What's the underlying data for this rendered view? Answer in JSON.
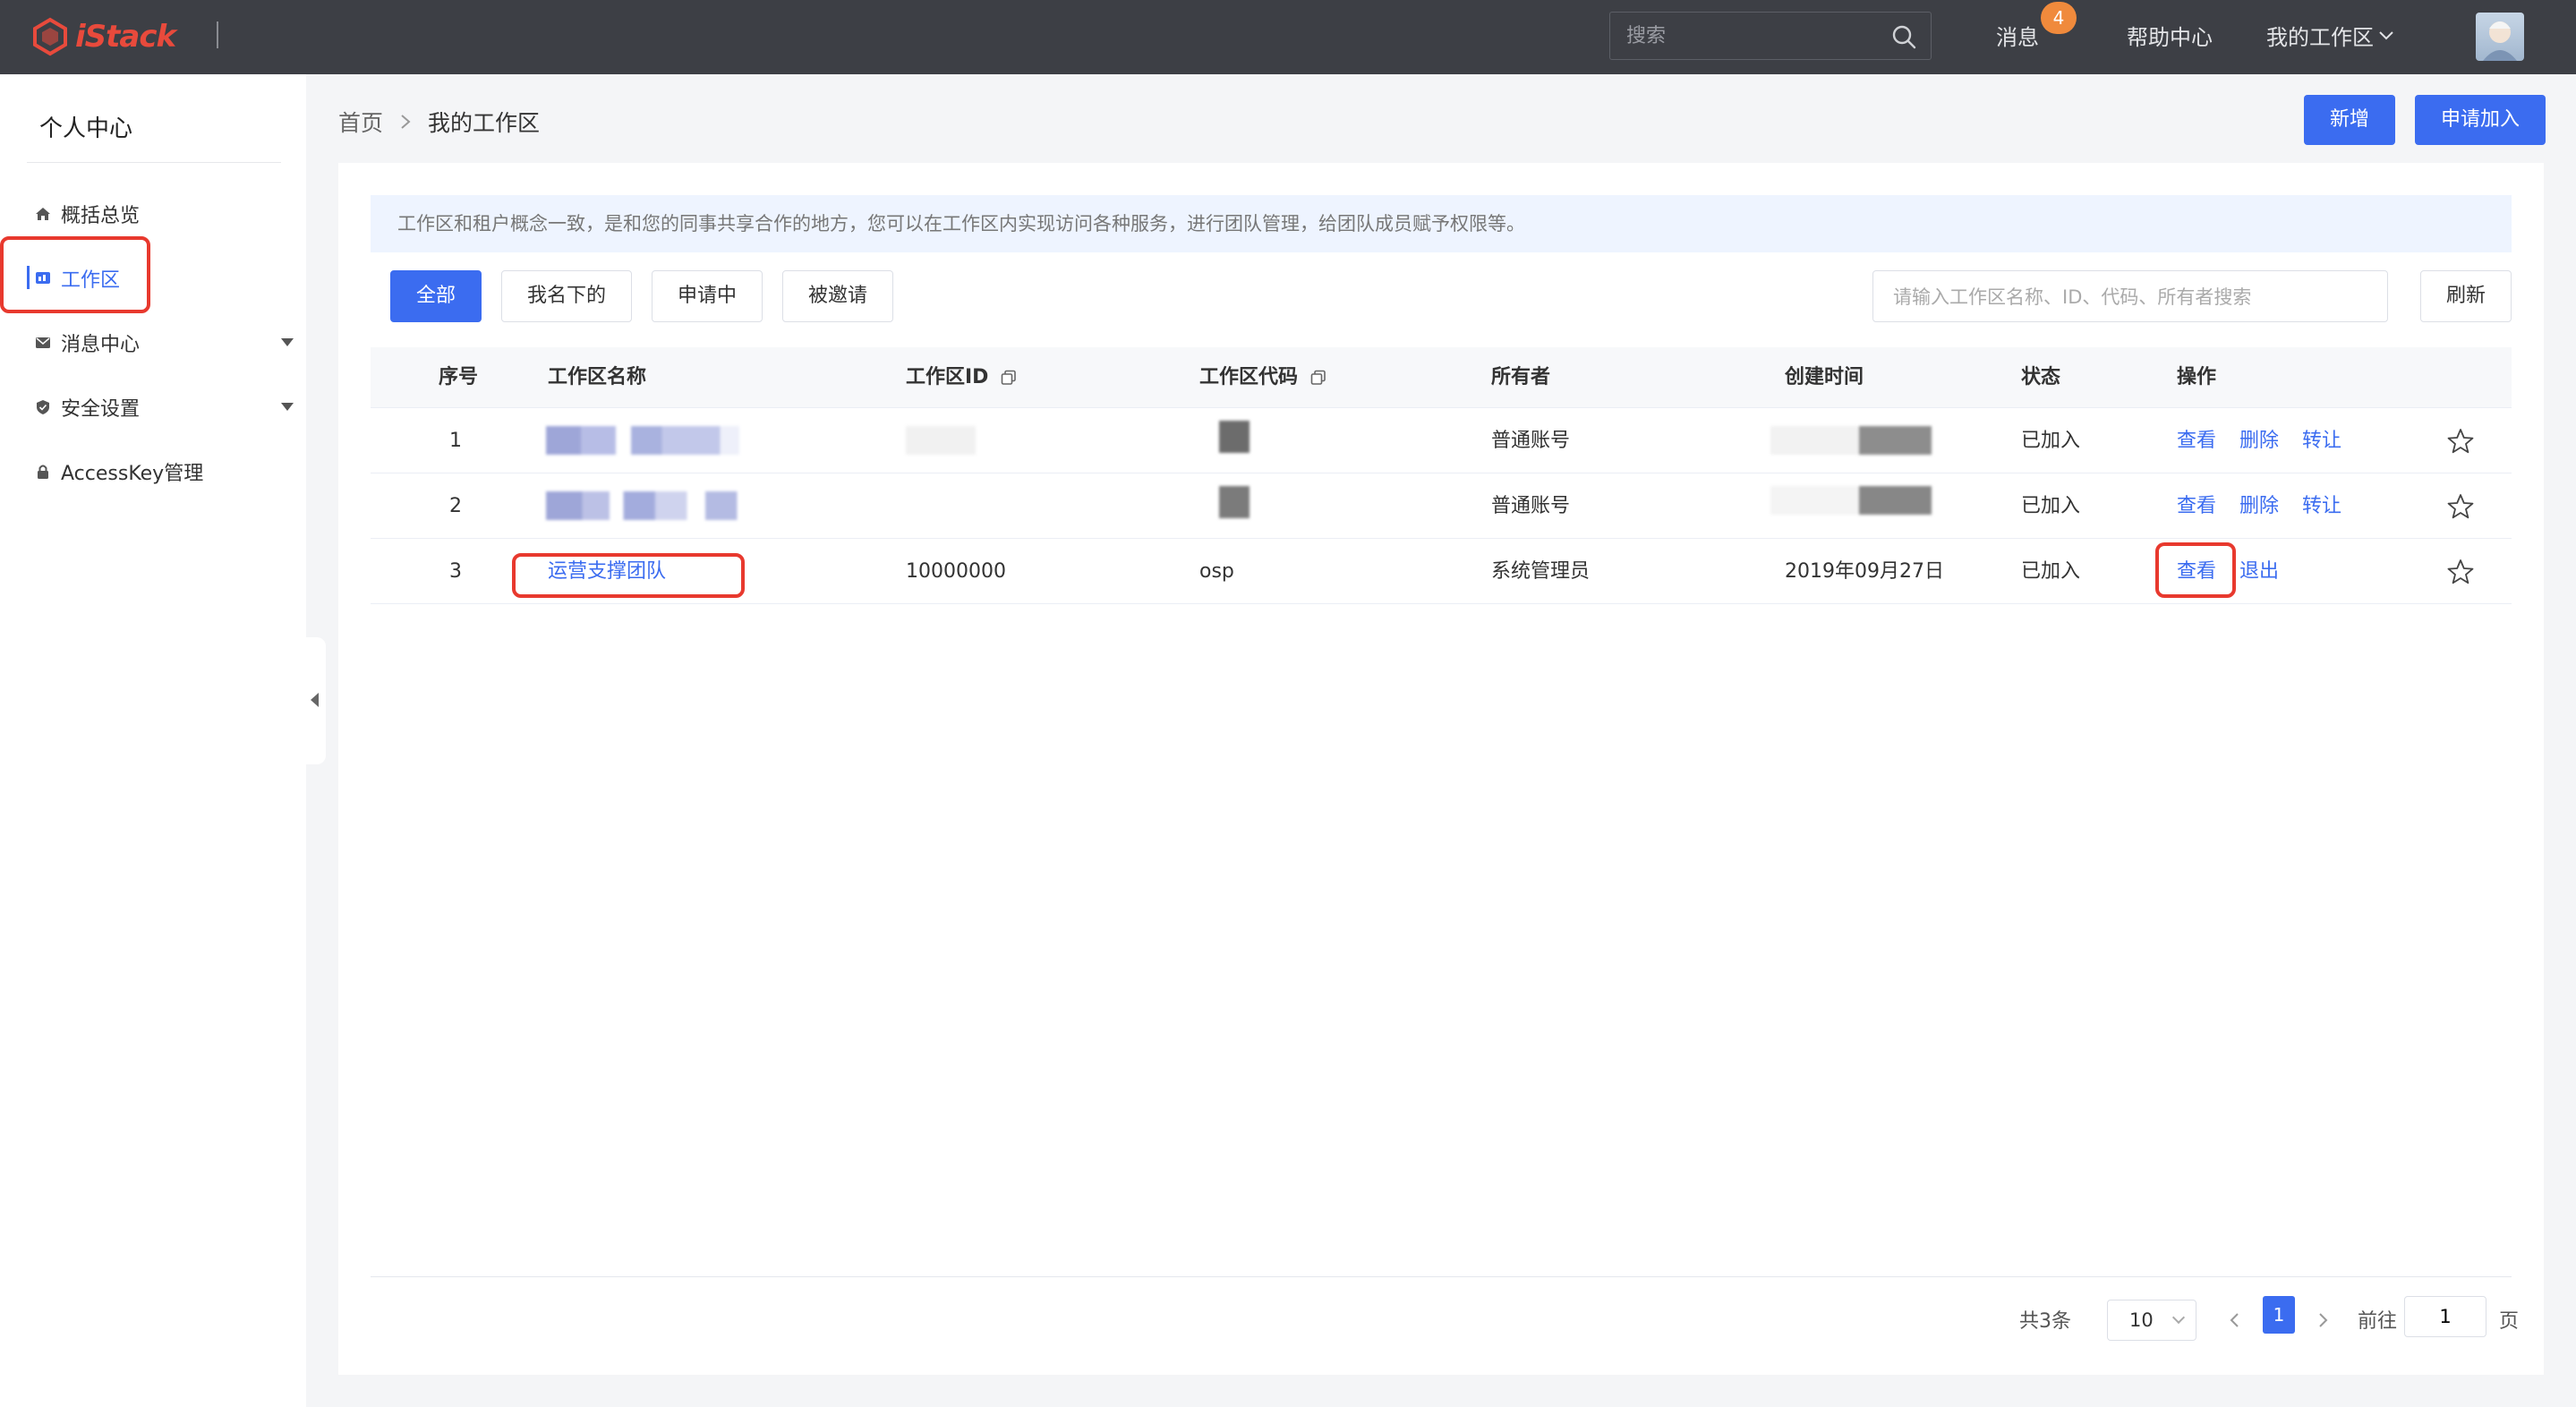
{
  "topbar": {
    "logo_text": "iStack",
    "search_placeholder": "搜索",
    "messages_label": "消息",
    "messages_badge": "4",
    "help_label": "帮助中心",
    "workspace_menu_label": "我的工作区"
  },
  "sidebar": {
    "title": "个人中心",
    "items": [
      {
        "label": "概括总览",
        "icon": "home-icon"
      },
      {
        "label": "工作区",
        "icon": "workspace-icon"
      },
      {
        "label": "消息中心",
        "icon": "mail-icon"
      },
      {
        "label": "安全设置",
        "icon": "shield-icon"
      },
      {
        "label": "AccessKey管理",
        "icon": "lock-icon"
      }
    ]
  },
  "breadcrumb": {
    "home": "首页",
    "current": "我的工作区"
  },
  "header_buttons": {
    "add": "新增",
    "apply_join": "申请加入"
  },
  "notice": "工作区和租户概念一致，是和您的同事共享合作的地方，您可以在工作区内实现访问各种服务，进行团队管理，给团队成员赋予权限等。",
  "filters": {
    "all": "全部",
    "mine": "我名下的",
    "applying": "申请中",
    "invited": "被邀请"
  },
  "search": {
    "placeholder": "请输入工作区名称、ID、代码、所有者搜索",
    "refresh": "刷新"
  },
  "table": {
    "headers": [
      "序号",
      "工作区名称",
      "工作区ID",
      "工作区代码",
      "所有者",
      "创建时间",
      "状态",
      "操作"
    ],
    "rows": [
      {
        "index": "1",
        "name": "",
        "id": "",
        "code": "",
        "owner": "普通账号",
        "created": "",
        "status": "已加入",
        "actions": [
          "查看",
          "删除",
          "转让"
        ]
      },
      {
        "index": "2",
        "name": "",
        "id": "",
        "code": "",
        "owner": "普通账号",
        "created": "",
        "status": "已加入",
        "actions": [
          "查看",
          "删除",
          "转让"
        ]
      },
      {
        "index": "3",
        "name": "运营支撑团队",
        "id": "10000000",
        "code": "osp",
        "owner": "系统管理员",
        "created": "2019年09月27日",
        "status": "已加入",
        "actions": [
          "查看",
          "退出"
        ]
      }
    ]
  },
  "pagination": {
    "total": "共3条",
    "page_size": "10",
    "current_page": "1",
    "goto_label": "前往",
    "goto_value": "1",
    "page_suffix": "页"
  },
  "colors": {
    "primary": "#3b6cf0",
    "topbar": "#3d3f45",
    "annotation": "#e8392e",
    "badge": "#f08a3c"
  }
}
